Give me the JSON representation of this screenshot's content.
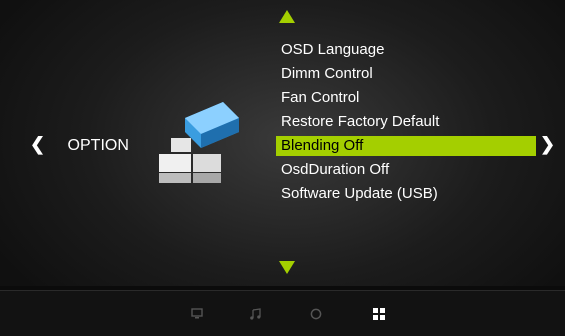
{
  "nav": {
    "left_arrow": "❮",
    "right_arrow": "❯",
    "category": "OPTION"
  },
  "menu": {
    "items": [
      {
        "label": "OSD Language"
      },
      {
        "label": "Dimm Control"
      },
      {
        "label": "Fan Control"
      },
      {
        "label": "Restore Factory Default"
      },
      {
        "label": "Blending Off"
      },
      {
        "label": "OsdDuration Off"
      },
      {
        "label": "Software Update (USB)"
      }
    ],
    "selected_index": 4
  },
  "bottom_tabs": [
    {
      "icon": "monitor-icon"
    },
    {
      "icon": "music-note-icon"
    },
    {
      "icon": "clock-icon"
    },
    {
      "icon": "option-grid-icon",
      "active": true
    }
  ],
  "colors": {
    "accent": "#a4cf00",
    "tile_blue": "#3a9de0",
    "tile_white": "#e6e6e6",
    "background": "#1c1c1c"
  }
}
